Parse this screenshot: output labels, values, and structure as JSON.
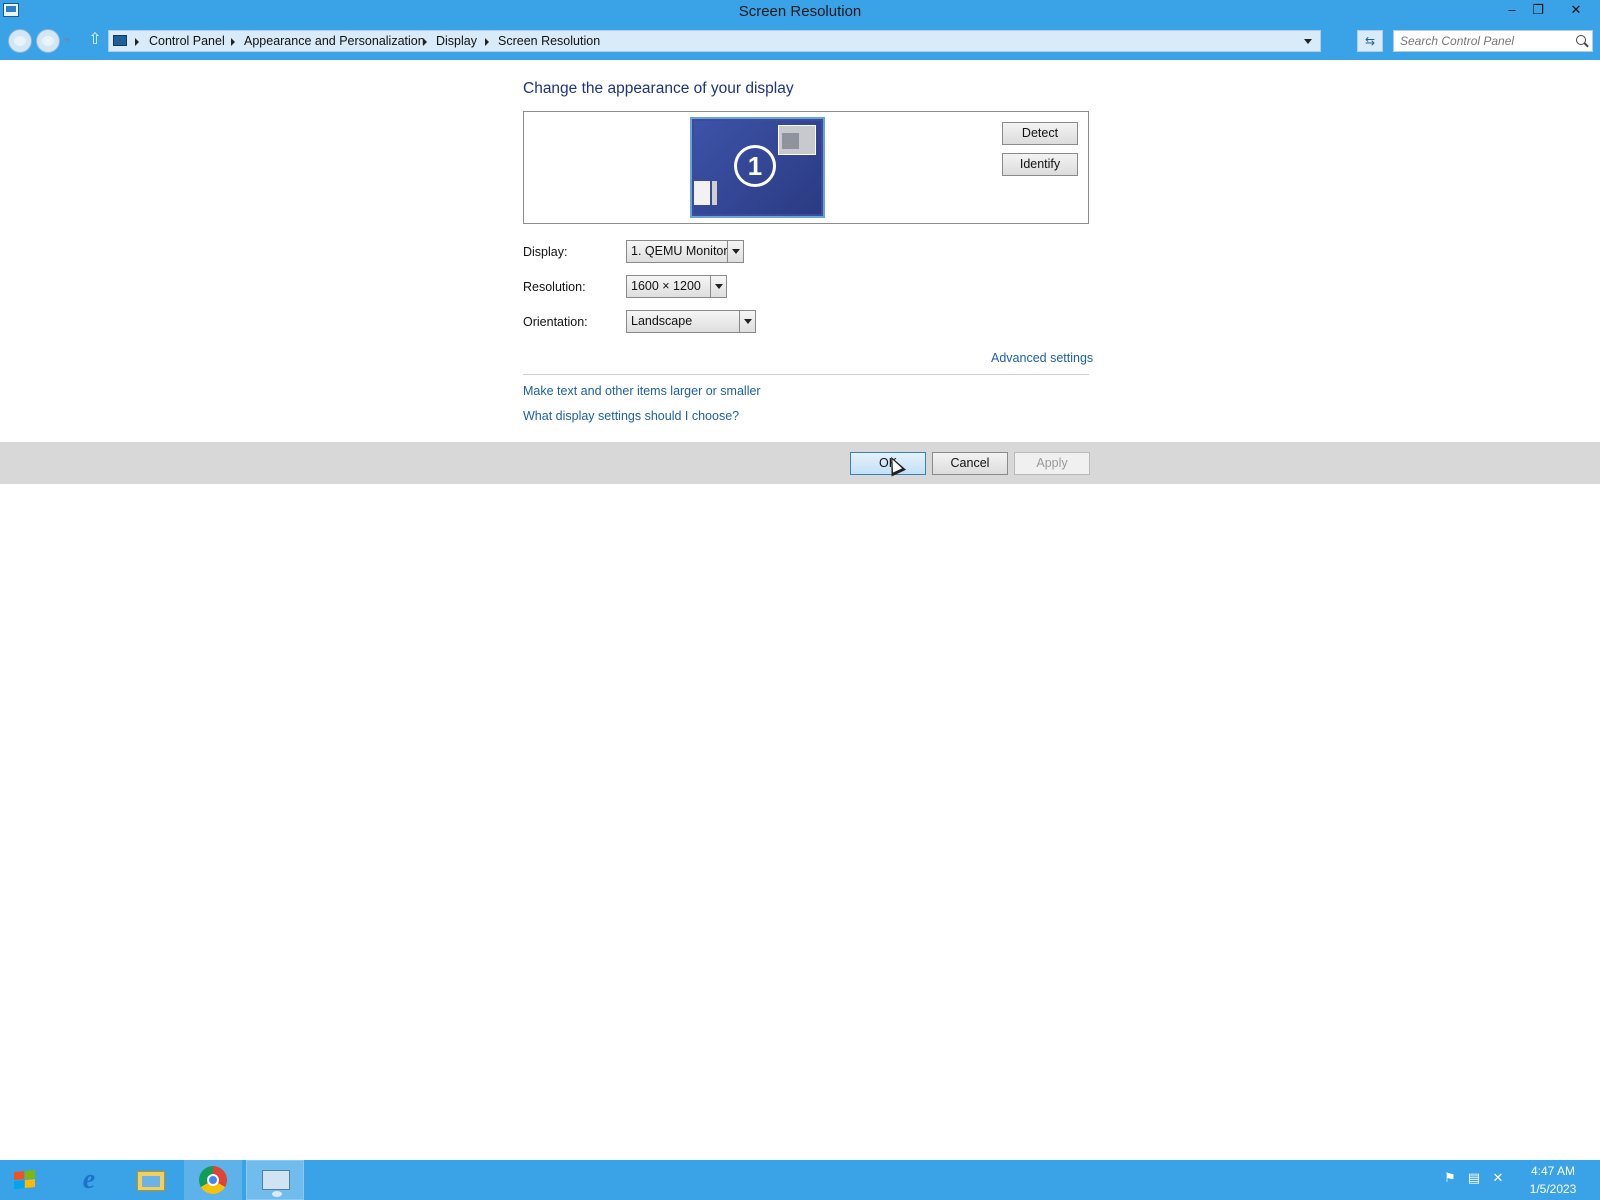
{
  "window": {
    "title": "Screen Resolution",
    "controls": {
      "minimize": "–",
      "restore": "❐",
      "close": "✕"
    }
  },
  "addressbar": {
    "breadcrumbs": [
      "Control Panel",
      "Appearance and Personalization",
      "Display",
      "Screen Resolution"
    ],
    "search_placeholder": "Search Control Panel"
  },
  "main": {
    "heading": "Change the appearance of your display",
    "monitor_number": "1",
    "detect_label": "Detect",
    "identify_label": "Identify",
    "display_label": "Display:",
    "display_value": "1. QEMU Monitor",
    "resolution_label": "Resolution:",
    "resolution_value": "1600 × 1200",
    "orientation_label": "Orientation:",
    "orientation_value": "Landscape",
    "advanced_link": "Advanced settings",
    "text_size_link": "Make text and other items larger or smaller",
    "help_link": "What display settings should I choose?"
  },
  "footer": {
    "ok_label": "OK",
    "cancel_label": "Cancel",
    "apply_label": "Apply"
  },
  "taskbar": {
    "items": [
      "start-button",
      "internet-explorer-icon",
      "file-explorer-icon",
      "chrome-icon",
      "control-panel-icon"
    ],
    "tray_icons": [
      "flag-icon",
      "network-icon",
      "speaker-muted-icon"
    ],
    "time": "4:47 AM",
    "date": "1/5/2023"
  },
  "colors": {
    "accent": "#3aa2e6",
    "heading": "#1e3287",
    "link": "#1e5fa6",
    "footer": "#d8d8d8"
  }
}
